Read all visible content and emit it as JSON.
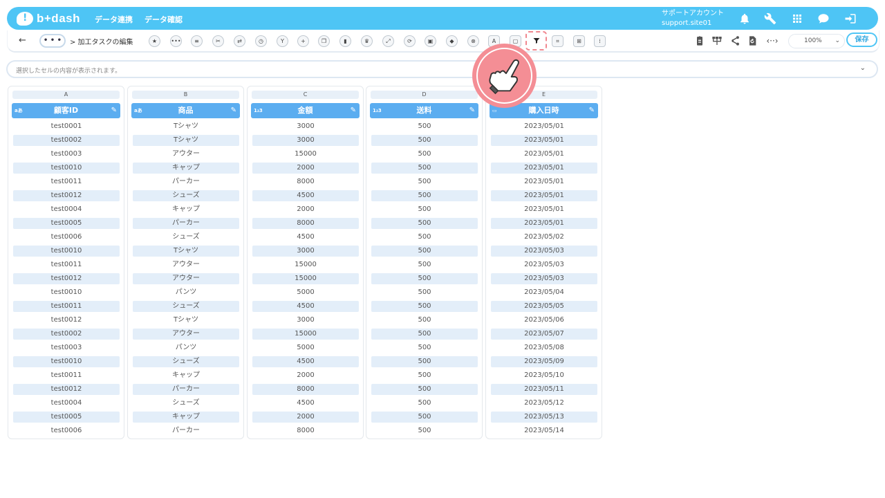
{
  "header": {
    "logo_text": "b+dash",
    "nav": [
      "データ連携",
      "データ確認"
    ],
    "account_name": "サポートアカウント",
    "account_id": "support.site01",
    "icons": [
      "bell-icon",
      "wrench-icon",
      "grid-icon",
      "chat-icon",
      "logout-icon"
    ]
  },
  "toolbar": {
    "more_label": "• • •",
    "breadcrumb": "> 加工タスクの編集",
    "tools": [
      "star-icon",
      "more-icon",
      "list-icon",
      "tools-icon",
      "swap-icon",
      "timer-icon",
      "merge-icon",
      "plus-icon",
      "copy-icon",
      "trash-icon",
      "crown-icon",
      "expand-icon",
      "refresh-icon",
      "lock-icon",
      "box-icon",
      "close-circle-icon",
      "text-replace-icon",
      "frame-icon",
      "filter-icon",
      "split-icon",
      "table-icon",
      "column-icon"
    ],
    "active_tool": "filter-icon",
    "zoom": "100%",
    "save_label": "保存"
  },
  "formula_bar": {
    "placeholder": "選択したセルの内容が表示されます。"
  },
  "columns": [
    {
      "letter": "A",
      "type": "aあ",
      "name": "顧客ID",
      "values": [
        "test0001",
        "test0002",
        "test0003",
        "test0010",
        "test0011",
        "test0012",
        "test0004",
        "test0005",
        "test0006",
        "test0010",
        "test0011",
        "test0012",
        "test0010",
        "test0011",
        "test0012",
        "test0002",
        "test0003",
        "test0010",
        "test0011",
        "test0012",
        "test0004",
        "test0005",
        "test0006"
      ]
    },
    {
      "letter": "B",
      "type": "aあ",
      "name": "商品",
      "values": [
        "Tシャツ",
        "Tシャツ",
        "アウター",
        "キャップ",
        "パーカー",
        "シューズ",
        "キャップ",
        "パーカー",
        "シューズ",
        "Tシャツ",
        "アウター",
        "アウター",
        "パンツ",
        "シューズ",
        "Tシャツ",
        "アウター",
        "パンツ",
        "シューズ",
        "キャップ",
        "パーカー",
        "シューズ",
        "キャップ",
        "パーカー"
      ]
    },
    {
      "letter": "C",
      "type": "1₂3",
      "name": "金額",
      "values": [
        "3000",
        "3000",
        "15000",
        "2000",
        "8000",
        "4500",
        "2000",
        "8000",
        "4500",
        "3000",
        "15000",
        "15000",
        "5000",
        "4500",
        "3000",
        "15000",
        "5000",
        "4500",
        "2000",
        "8000",
        "4500",
        "2000",
        "8000"
      ]
    },
    {
      "letter": "D",
      "type": "1₂3",
      "name": "送料",
      "values": [
        "500",
        "500",
        "500",
        "500",
        "500",
        "500",
        "500",
        "500",
        "500",
        "500",
        "500",
        "500",
        "500",
        "500",
        "500",
        "500",
        "500",
        "500",
        "500",
        "500",
        "500",
        "500",
        "500"
      ]
    },
    {
      "letter": "E",
      "type": "▭",
      "name": "購入日時",
      "values": [
        "2023/05/01",
        "2023/05/01",
        "2023/05/01",
        "2023/05/01",
        "2023/05/01",
        "2023/05/01",
        "2023/05/01",
        "2023/05/01",
        "2023/05/02",
        "2023/05/03",
        "2023/05/03",
        "2023/05/03",
        "2023/05/04",
        "2023/05/05",
        "2023/05/06",
        "2023/05/07",
        "2023/05/08",
        "2023/05/09",
        "2023/05/10",
        "2023/05/11",
        "2023/05/12",
        "2023/05/13",
        "2023/05/14"
      ]
    }
  ]
}
